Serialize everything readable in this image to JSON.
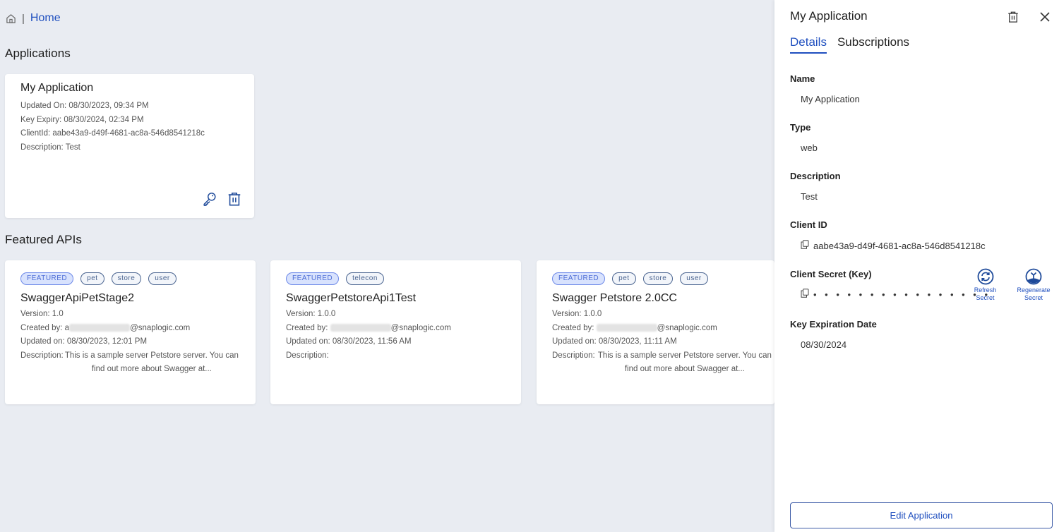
{
  "breadcrumb": {
    "home_icon": "home-icon",
    "separator": "|",
    "current": "Home"
  },
  "applications": {
    "title": "Applications",
    "cards": [
      {
        "name": "My Application",
        "updated_on": "Updated On: 08/30/2023, 09:34 PM",
        "key_expiry": "Key Expiry: 08/30/2024, 02:34 PM",
        "client_id": "ClientId: aabe43a9-d49f-4681-ac8a-546d8541218c",
        "description": "Description: Test",
        "actions": [
          "key-icon",
          "trash-icon"
        ]
      }
    ]
  },
  "featured": {
    "title": "Featured APIs",
    "cards": [
      {
        "tags": [
          "FEATURED",
          "pet",
          "store",
          "user"
        ],
        "name": "SwaggerApiPetStage2",
        "version": "Version: 1.0",
        "created_by_label": "Created by:",
        "created_by_prefix": "a",
        "created_by_domain": "@snaplogic.com",
        "updated_on": "Updated on: 08/30/2023, 12:01 PM",
        "description_label": "Description:",
        "description": "This is a sample server Petstore server. You can find out more about Swagger at..."
      },
      {
        "tags": [
          "FEATURED",
          "telecon"
        ],
        "name": "SwaggerPetstoreApi1Test",
        "version": "Version: 1.0.0",
        "created_by_label": "Created by:",
        "created_by_prefix": "",
        "created_by_domain": "@snaplogic.com",
        "updated_on": "Updated on: 08/30/2023, 11:56 AM",
        "description_label": "Description:",
        "description": ""
      },
      {
        "tags": [
          "FEATURED",
          "pet",
          "store",
          "user"
        ],
        "name": "Swagger Petstore 2.0CC",
        "version": "Version: 1.0.0",
        "created_by_label": "Created by:",
        "created_by_prefix": "",
        "created_by_domain": "@snaplogic.com",
        "updated_on": "Updated on: 08/30/2023, 11:11 AM",
        "description_label": "Description:",
        "description": "This is a sample server Petstore server. You can find out more about Swagger at..."
      }
    ]
  },
  "panel": {
    "title": "My Application",
    "tabs": [
      {
        "label": "Details",
        "active": true
      },
      {
        "label": "Subscriptions",
        "active": false
      }
    ],
    "fields": {
      "name": {
        "label": "Name",
        "value": "My Application"
      },
      "type": {
        "label": "Type",
        "value": "web"
      },
      "description": {
        "label": "Description",
        "value": "Test"
      },
      "client_id": {
        "label": "Client ID",
        "value": "aabe43a9-d49f-4681-ac8a-546d8541218c"
      },
      "client_secret": {
        "label": "Client Secret (Key)",
        "value": "• • • • • • • • • • • • • • • •"
      },
      "key_expiration": {
        "label": "Key Expiration Date",
        "value": "08/30/2024"
      }
    },
    "secret_actions": {
      "refresh": [
        "Refresh",
        "Secret"
      ],
      "regenerate": [
        "Regenerate",
        "Secret"
      ]
    },
    "edit_button": "Edit Application"
  },
  "colors": {
    "accent": "#1f4fbf",
    "background": "#e9ecf2",
    "tag_featured_bg": "#d8e2fd",
    "tag_border": "#4a6490"
  }
}
